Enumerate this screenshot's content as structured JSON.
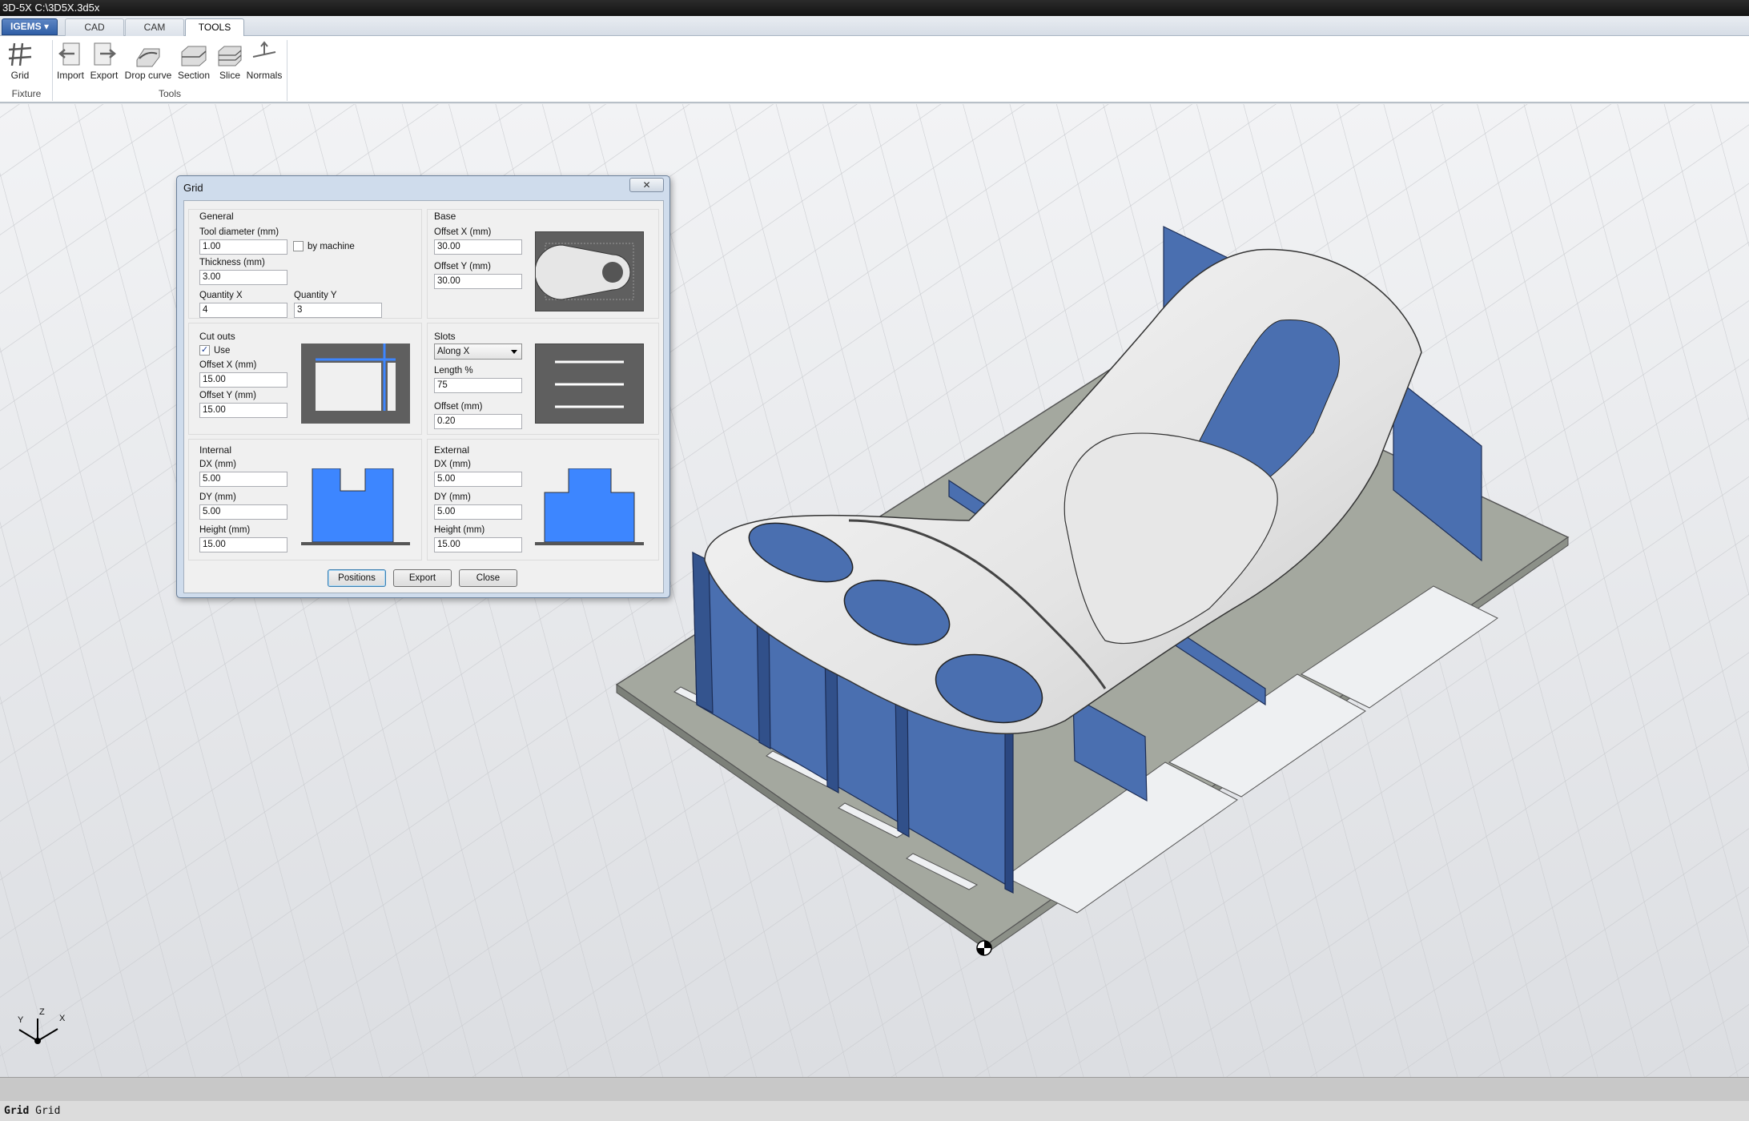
{
  "window": {
    "title": "3D-5X C:\\3D5X.3d5x"
  },
  "app_menu": {
    "label": "IGEMS ▾"
  },
  "tabs": [
    {
      "label": "CAD"
    },
    {
      "label": "CAM"
    },
    {
      "label": "TOOLS",
      "active": true
    }
  ],
  "ribbon": {
    "groups": [
      {
        "label": "Fixture"
      },
      {
        "label": "Tools"
      }
    ],
    "buttons": [
      {
        "label": "Grid",
        "icon": "grid-icon"
      },
      {
        "label": "Import",
        "icon": "import-icon"
      },
      {
        "label": "Export",
        "icon": "export-icon"
      },
      {
        "label": "Drop curve",
        "icon": "drop-curve-icon"
      },
      {
        "label": "Section",
        "icon": "section-icon"
      },
      {
        "label": "Slice",
        "icon": "slice-icon"
      },
      {
        "label": "Normals",
        "icon": "normals-icon"
      }
    ]
  },
  "dialog": {
    "title": "Grid",
    "close_glyph": "✕",
    "general": {
      "title": "General",
      "tool_diameter_label": "Tool diameter (mm)",
      "tool_diameter": "1.00",
      "by_machine_label": "by machine",
      "by_machine_checked": false,
      "thickness_label": "Thickness (mm)",
      "thickness": "3.00",
      "quantity_x_label": "Quantity X",
      "quantity_x": "4",
      "quantity_y_label": "Quantity Y",
      "quantity_y": "3"
    },
    "base": {
      "title": "Base",
      "offset_x_label": "Offset X (mm)",
      "offset_x": "30.00",
      "offset_y_label": "Offset Y (mm)",
      "offset_y": "30.00"
    },
    "cutouts": {
      "title": "Cut outs",
      "use_label": "Use",
      "use_checked": true,
      "check_glyph": "✓",
      "offset_x_label": "Offset X (mm)",
      "offset_x": "15.00",
      "offset_y_label": "Offset Y (mm)",
      "offset_y": "15.00"
    },
    "slots": {
      "title": "Slots",
      "direction": "Along X",
      "length_label": "Length %",
      "length": "75",
      "offset_label": "Offset (mm)",
      "offset": "0.20"
    },
    "internal": {
      "title": "Internal",
      "dx_label": "DX (mm)",
      "dx": "5.00",
      "dy_label": "DY (mm)",
      "dy": "5.00",
      "height_label": "Height (mm)",
      "height": "15.00"
    },
    "external": {
      "title": "External",
      "dx_label": "DX (mm)",
      "dx": "5.00",
      "dy_label": "DY (mm)",
      "dy": "5.00",
      "height_label": "Height (mm)",
      "height": "15.00"
    },
    "buttons": {
      "positions": "Positions",
      "export": "Export",
      "close": "Close"
    }
  },
  "axis_triad": {
    "x": "X",
    "y": "Y",
    "z": "Z"
  },
  "command_line": {
    "command": "Grid",
    "echo": "Grid"
  },
  "colors": {
    "blue_rib": "#4a6fb0",
    "plate": "#a3a79e",
    "part": "#ededed",
    "accent": "#3d86ff",
    "viewport_bg": "#e6e7ea"
  }
}
